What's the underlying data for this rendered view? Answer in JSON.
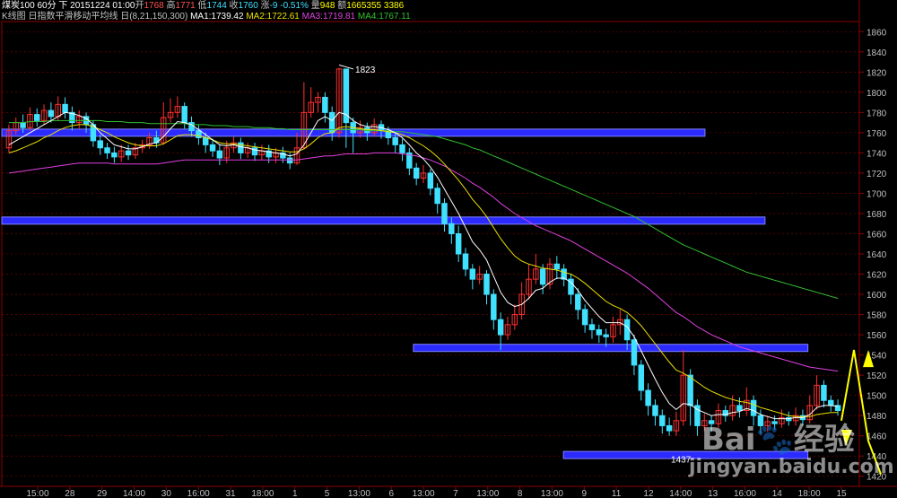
{
  "header": {
    "line1": {
      "symbol": "煤炭100 60分 下",
      "date": "20151224 01:00",
      "open_label": "开",
      "open": "1768",
      "high_label": "高",
      "high": "1771",
      "low_label": "低",
      "low": "1744",
      "close_label": "收",
      "close": "1760",
      "change_label": "涨",
      "change": "-9 -0.51%",
      "volume_label": "量",
      "volume": "948",
      "amount_label": "额",
      "amount": "1665355 3386"
    },
    "line2": {
      "indicator": "K线图 日指数平滑移动平均线 日(8,21,150,300)",
      "ma1": "MA1:1739.42",
      "ma2": "MA2:1722.61",
      "ma3": "MA3:1719.81",
      "ma4": "MA4:1767.11"
    }
  },
  "colors": {
    "up": "#ff3030",
    "down": "#40e0ff",
    "ma1": "#ffffff",
    "ma2": "#e8e000",
    "ma3": "#e040e0",
    "ma4": "#30c030",
    "band": "#2b2bff",
    "arrow": "#ffff00",
    "grid": "#8b0000",
    "axis_text": "#c0c0c0"
  },
  "chart_data": {
    "type": "candlestick",
    "ylim": [
      1410,
      1870
    ],
    "y_ticks": [
      1420,
      1440,
      1460,
      1480,
      1500,
      1520,
      1540,
      1560,
      1580,
      1600,
      1620,
      1640,
      1660,
      1680,
      1700,
      1720,
      1740,
      1760,
      1780,
      1800,
      1820,
      1840,
      1860
    ],
    "x_labels": [
      "15:00",
      "28",
      "29",
      "14:00",
      "30",
      "16:00",
      "31",
      "18:00",
      "1",
      "5",
      "13:00",
      "6",
      "13:00",
      "7",
      "13:00",
      "8",
      "13:00",
      "9",
      "11",
      "12",
      "14:00",
      "13",
      "16:00",
      "14",
      "18:00",
      "15"
    ],
    "annotations": [
      {
        "label": "1823",
        "value": 1823
      },
      {
        "label": "1437",
        "value": 1437
      }
    ],
    "support_bands": [
      {
        "from": 0.0,
        "to": 0.82,
        "value": 1760
      },
      {
        "from": 0.0,
        "to": 0.89,
        "value": 1673
      },
      {
        "from": 0.48,
        "to": 0.94,
        "value": 1547
      },
      {
        "from": 0.655,
        "to": 0.94,
        "value": 1441
      }
    ],
    "candles": [
      [
        1745,
        1762,
        1768,
        1740
      ],
      [
        1762,
        1770,
        1775,
        1758
      ],
      [
        1770,
        1765,
        1778,
        1760
      ],
      [
        1765,
        1778,
        1785,
        1762
      ],
      [
        1778,
        1772,
        1784,
        1766
      ],
      [
        1772,
        1782,
        1788,
        1768
      ],
      [
        1782,
        1776,
        1790,
        1770
      ],
      [
        1776,
        1788,
        1796,
        1772
      ],
      [
        1788,
        1780,
        1795,
        1774
      ],
      [
        1780,
        1770,
        1786,
        1762
      ],
      [
        1770,
        1776,
        1782,
        1764
      ],
      [
        1776,
        1768,
        1780,
        1760
      ],
      [
        1768,
        1752,
        1772,
        1746
      ],
      [
        1752,
        1745,
        1758,
        1738
      ],
      [
        1745,
        1740,
        1750,
        1734
      ],
      [
        1740,
        1736,
        1746,
        1730
      ],
      [
        1736,
        1742,
        1748,
        1731
      ],
      [
        1742,
        1738,
        1748,
        1733
      ],
      [
        1738,
        1745,
        1750,
        1734
      ],
      [
        1745,
        1748,
        1753,
        1740
      ],
      [
        1748,
        1755,
        1760,
        1744
      ],
      [
        1755,
        1750,
        1762,
        1745
      ],
      [
        1750,
        1775,
        1790,
        1748
      ],
      [
        1775,
        1780,
        1794,
        1770
      ],
      [
        1780,
        1786,
        1796,
        1775
      ],
      [
        1786,
        1770,
        1790,
        1764
      ],
      [
        1770,
        1762,
        1776,
        1756
      ],
      [
        1762,
        1755,
        1768,
        1748
      ],
      [
        1755,
        1748,
        1760,
        1740
      ],
      [
        1748,
        1742,
        1754,
        1736
      ],
      [
        1742,
        1735,
        1748,
        1728
      ],
      [
        1735,
        1745,
        1752,
        1730
      ],
      [
        1745,
        1750,
        1756,
        1740
      ],
      [
        1750,
        1740,
        1755,
        1734
      ],
      [
        1740,
        1745,
        1750,
        1735
      ],
      [
        1745,
        1738,
        1750,
        1732
      ],
      [
        1738,
        1742,
        1748,
        1733
      ],
      [
        1742,
        1736,
        1748,
        1730
      ],
      [
        1736,
        1740,
        1745,
        1730
      ],
      [
        1740,
        1735,
        1746,
        1730
      ],
      [
        1735,
        1730,
        1740,
        1724
      ],
      [
        1730,
        1745,
        1760,
        1728
      ],
      [
        1745,
        1780,
        1810,
        1744
      ],
      [
        1780,
        1790,
        1805,
        1775
      ],
      [
        1790,
        1795,
        1800,
        1780
      ],
      [
        1795,
        1780,
        1800,
        1770
      ],
      [
        1780,
        1760,
        1786,
        1752
      ],
      [
        1760,
        1823,
        1824,
        1755
      ],
      [
        1823,
        1770,
        1810,
        1745
      ],
      [
        1770,
        1760,
        1775,
        1740
      ],
      [
        1760,
        1765,
        1772,
        1755
      ],
      [
        1765,
        1760,
        1770,
        1752
      ],
      [
        1760,
        1768,
        1774,
        1756
      ],
      [
        1768,
        1762,
        1772,
        1754
      ],
      [
        1762,
        1755,
        1766,
        1748
      ],
      [
        1755,
        1748,
        1760,
        1740
      ],
      [
        1748,
        1740,
        1754,
        1732
      ],
      [
        1740,
        1725,
        1745,
        1718
      ],
      [
        1725,
        1715,
        1730,
        1708
      ],
      [
        1715,
        1720,
        1728,
        1710
      ],
      [
        1720,
        1705,
        1724,
        1698
      ],
      [
        1705,
        1690,
        1710,
        1680
      ],
      [
        1690,
        1670,
        1695,
        1662
      ],
      [
        1670,
        1660,
        1676,
        1650
      ],
      [
        1660,
        1640,
        1668,
        1632
      ],
      [
        1640,
        1625,
        1646,
        1618
      ],
      [
        1625,
        1615,
        1630,
        1605
      ],
      [
        1615,
        1620,
        1628,
        1610
      ],
      [
        1620,
        1600,
        1624,
        1590
      ],
      [
        1600,
        1575,
        1605,
        1565
      ],
      [
        1575,
        1560,
        1582,
        1545
      ],
      [
        1560,
        1570,
        1578,
        1555
      ],
      [
        1570,
        1580,
        1590,
        1565
      ],
      [
        1580,
        1600,
        1612,
        1575
      ],
      [
        1600,
        1615,
        1630,
        1595
      ],
      [
        1615,
        1625,
        1640,
        1610
      ],
      [
        1625,
        1610,
        1630,
        1600
      ],
      [
        1610,
        1630,
        1636,
        1605
      ],
      [
        1630,
        1625,
        1638,
        1615
      ],
      [
        1625,
        1615,
        1630,
        1608
      ],
      [
        1615,
        1600,
        1620,
        1590
      ],
      [
        1600,
        1585,
        1606,
        1575
      ],
      [
        1585,
        1570,
        1590,
        1562
      ],
      [
        1570,
        1565,
        1576,
        1556
      ],
      [
        1565,
        1560,
        1570,
        1552
      ],
      [
        1560,
        1558,
        1566,
        1548
      ],
      [
        1558,
        1570,
        1578,
        1552
      ],
      [
        1570,
        1575,
        1585,
        1560
      ],
      [
        1575,
        1555,
        1580,
        1545
      ],
      [
        1555,
        1530,
        1560,
        1520
      ],
      [
        1530,
        1505,
        1535,
        1495
      ],
      [
        1505,
        1490,
        1512,
        1480
      ],
      [
        1490,
        1480,
        1496,
        1470
      ],
      [
        1480,
        1470,
        1486,
        1462
      ],
      [
        1470,
        1465,
        1478,
        1460
      ],
      [
        1465,
        1475,
        1484,
        1460
      ],
      [
        1475,
        1520,
        1545,
        1470
      ],
      [
        1520,
        1490,
        1526,
        1470
      ],
      [
        1490,
        1470,
        1496,
        1460
      ],
      [
        1470,
        1475,
        1482,
        1465
      ],
      [
        1475,
        1472,
        1480,
        1464
      ],
      [
        1472,
        1485,
        1492,
        1468
      ],
      [
        1485,
        1480,
        1490,
        1474
      ],
      [
        1480,
        1490,
        1500,
        1475
      ],
      [
        1490,
        1485,
        1498,
        1478
      ],
      [
        1485,
        1495,
        1508,
        1480
      ],
      [
        1495,
        1480,
        1500,
        1470
      ],
      [
        1480,
        1470,
        1486,
        1462
      ],
      [
        1470,
        1474,
        1480,
        1464
      ],
      [
        1474,
        1472,
        1480,
        1466
      ],
      [
        1472,
        1478,
        1486,
        1468
      ],
      [
        1478,
        1475,
        1484,
        1470
      ],
      [
        1475,
        1480,
        1488,
        1470
      ],
      [
        1480,
        1476,
        1486,
        1470
      ],
      [
        1476,
        1490,
        1500,
        1472
      ],
      [
        1490,
        1510,
        1520,
        1486
      ],
      [
        1510,
        1495,
        1515,
        1488
      ],
      [
        1495,
        1490,
        1500,
        1484
      ],
      [
        1490,
        1485,
        1496,
        1480
      ]
    ],
    "ma1": [
      1748,
      1752,
      1756,
      1760,
      1764,
      1768,
      1772,
      1776,
      1780,
      1779,
      1777,
      1774,
      1768,
      1760,
      1754,
      1748,
      1746,
      1744,
      1744,
      1746,
      1749,
      1750,
      1756,
      1764,
      1771,
      1770,
      1768,
      1763,
      1758,
      1753,
      1748,
      1747,
      1748,
      1746,
      1745,
      1743,
      1742,
      1741,
      1740,
      1739,
      1737,
      1739,
      1748,
      1760,
      1772,
      1776,
      1772,
      1780,
      1778,
      1772,
      1768,
      1766,
      1766,
      1765,
      1763,
      1760,
      1755,
      1748,
      1740,
      1734,
      1726,
      1716,
      1704,
      1692,
      1680,
      1666,
      1652,
      1644,
      1634,
      1618,
      1602,
      1592,
      1588,
      1590,
      1596,
      1604,
      1606,
      1612,
      1616,
      1616,
      1612,
      1604,
      1594,
      1586,
      1578,
      1572,
      1572,
      1572,
      1568,
      1558,
      1544,
      1530,
      1516,
      1503,
      1492,
      1486,
      1492,
      1491,
      1486,
      1483,
      1480,
      1481,
      1481,
      1483,
      1484,
      1487,
      1485,
      1481,
      1479,
      1477,
      1477,
      1477,
      1478,
      1478,
      1481,
      1488,
      1490,
      1490,
      1489
    ],
    "ma2": [
      1740,
      1742,
      1745,
      1748,
      1751,
      1755,
      1758,
      1762,
      1765,
      1767,
      1768,
      1768,
      1766,
      1763,
      1760,
      1756,
      1753,
      1750,
      1748,
      1747,
      1747,
      1747,
      1749,
      1753,
      1757,
      1758,
      1758,
      1757,
      1755,
      1753,
      1750,
      1749,
      1749,
      1748,
      1747,
      1746,
      1745,
      1744,
      1743,
      1742,
      1741,
      1741,
      1744,
      1749,
      1755,
      1759,
      1760,
      1765,
      1766,
      1765,
      1764,
      1763,
      1763,
      1762,
      1761,
      1760,
      1758,
      1755,
      1751,
      1747,
      1742,
      1736,
      1729,
      1721,
      1713,
      1704,
      1694,
      1686,
      1677,
      1666,
      1655,
      1646,
      1638,
      1633,
      1630,
      1628,
      1626,
      1625,
      1624,
      1622,
      1620,
      1616,
      1611,
      1605,
      1599,
      1593,
      1589,
      1586,
      1582,
      1576,
      1569,
      1560,
      1551,
      1542,
      1533,
      1525,
      1522,
      1518,
      1513,
      1508,
      1504,
      1501,
      1498,
      1496,
      1494,
      1493,
      1491,
      1488,
      1486,
      1484,
      1482,
      1480,
      1479,
      1479,
      1479,
      1481,
      1482,
      1483,
      1483
    ],
    "ma3": [
      1720,
      1721,
      1722,
      1723,
      1724,
      1725,
      1726,
      1727,
      1728,
      1729,
      1730,
      1730,
      1730,
      1730,
      1730,
      1729,
      1729,
      1729,
      1729,
      1729,
      1729,
      1729,
      1730,
      1731,
      1732,
      1733,
      1733,
      1733,
      1733,
      1733,
      1733,
      1733,
      1733,
      1733,
      1733,
      1733,
      1733,
      1733,
      1733,
      1733,
      1733,
      1733,
      1734,
      1735,
      1736,
      1737,
      1737,
      1738,
      1739,
      1739,
      1739,
      1739,
      1740,
      1740,
      1740,
      1740,
      1739,
      1738,
      1737,
      1735,
      1733,
      1730,
      1727,
      1723,
      1719,
      1715,
      1710,
      1706,
      1701,
      1696,
      1690,
      1685,
      1680,
      1676,
      1672,
      1668,
      1665,
      1662,
      1659,
      1656,
      1653,
      1649,
      1645,
      1641,
      1637,
      1633,
      1629,
      1625,
      1621,
      1616,
      1611,
      1606,
      1600,
      1594,
      1588,
      1582,
      1578,
      1573,
      1568,
      1564,
      1560,
      1557,
      1554,
      1551,
      1548,
      1546,
      1544,
      1542,
      1540,
      1538,
      1536,
      1534,
      1532,
      1530,
      1528,
      1527,
      1526,
      1525,
      1524
    ],
    "ma4": [
      1770,
      1770,
      1770,
      1771,
      1771,
      1771,
      1772,
      1772,
      1772,
      1772,
      1772,
      1772,
      1772,
      1772,
      1771,
      1771,
      1771,
      1770,
      1770,
      1770,
      1769,
      1769,
      1769,
      1769,
      1769,
      1769,
      1768,
      1768,
      1768,
      1767,
      1767,
      1767,
      1766,
      1766,
      1766,
      1765,
      1765,
      1765,
      1764,
      1764,
      1763,
      1763,
      1763,
      1763,
      1763,
      1763,
      1763,
      1763,
      1763,
      1763,
      1763,
      1762,
      1762,
      1762,
      1762,
      1761,
      1761,
      1760,
      1759,
      1758,
      1757,
      1756,
      1754,
      1752,
      1750,
      1748,
      1745,
      1743,
      1740,
      1737,
      1734,
      1731,
      1728,
      1725,
      1722,
      1719,
      1716,
      1713,
      1710,
      1707,
      1704,
      1701,
      1698,
      1695,
      1692,
      1689,
      1686,
      1683,
      1680,
      1677,
      1673,
      1669,
      1665,
      1661,
      1657,
      1653,
      1649,
      1646,
      1643,
      1640,
      1637,
      1634,
      1631,
      1628,
      1625,
      1622,
      1620,
      1618,
      1616,
      1614,
      1612,
      1610,
      1608,
      1606,
      1604,
      1602,
      1600,
      1598,
      1596
    ]
  },
  "watermark": {
    "brand": "Bai",
    "brand2": "经验",
    "url": "jingyan.baidu.com"
  }
}
